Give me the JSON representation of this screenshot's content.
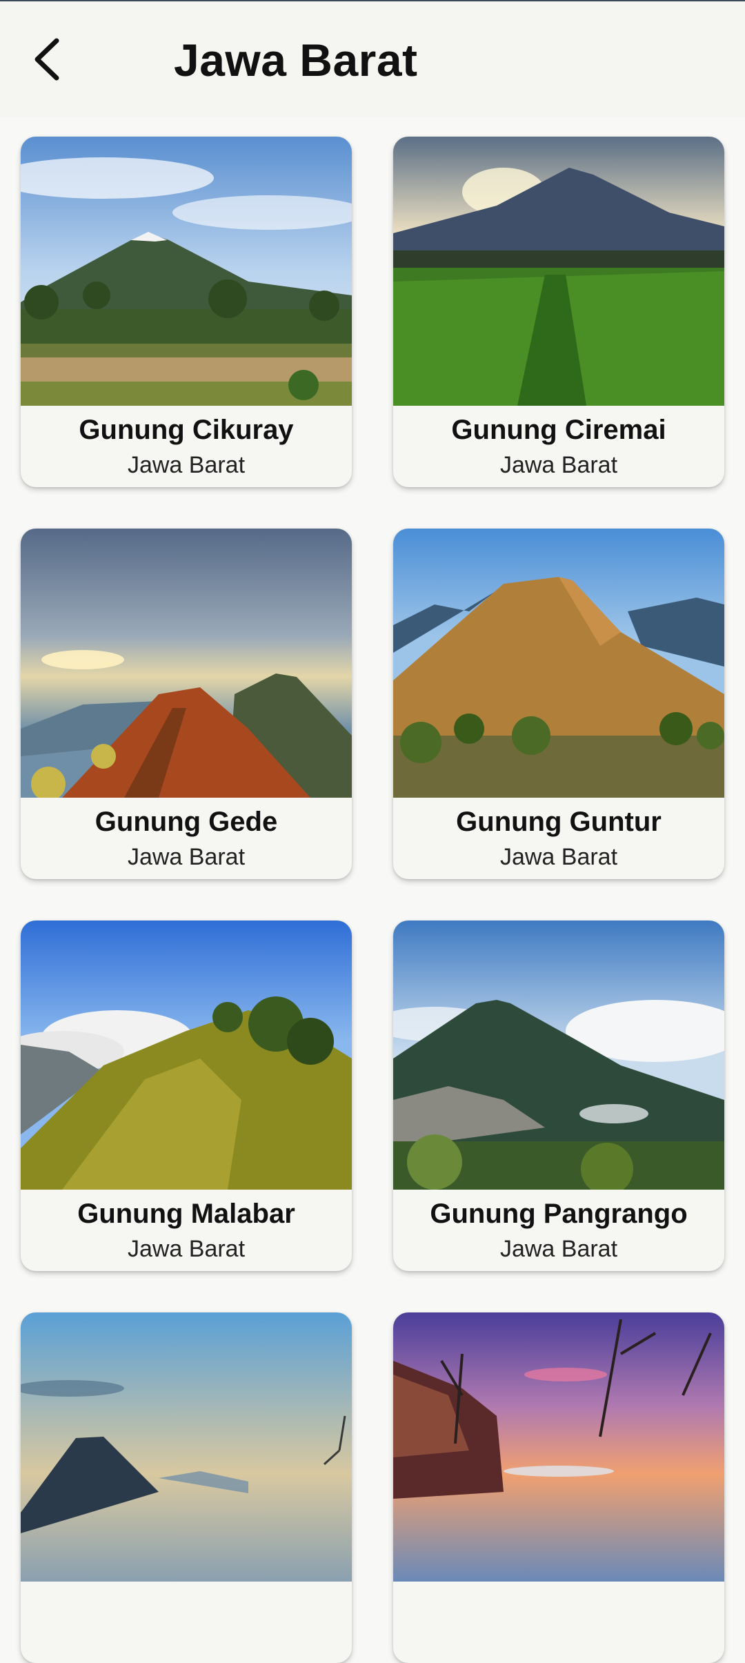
{
  "header": {
    "title": "Jawa Barat",
    "back_icon": "chevron-left-icon"
  },
  "mountains": [
    {
      "name": "Gunung Cikuray",
      "region": "Jawa Barat"
    },
    {
      "name": "Gunung Ciremai",
      "region": "Jawa Barat"
    },
    {
      "name": "Gunung Gede",
      "region": "Jawa Barat"
    },
    {
      "name": "Gunung Guntur",
      "region": "Jawa Barat"
    },
    {
      "name": "Gunung Malabar",
      "region": "Jawa Barat"
    },
    {
      "name": "Gunung Pangrango",
      "region": "Jawa Barat"
    },
    {
      "name": "",
      "region": ""
    },
    {
      "name": "",
      "region": ""
    }
  ]
}
